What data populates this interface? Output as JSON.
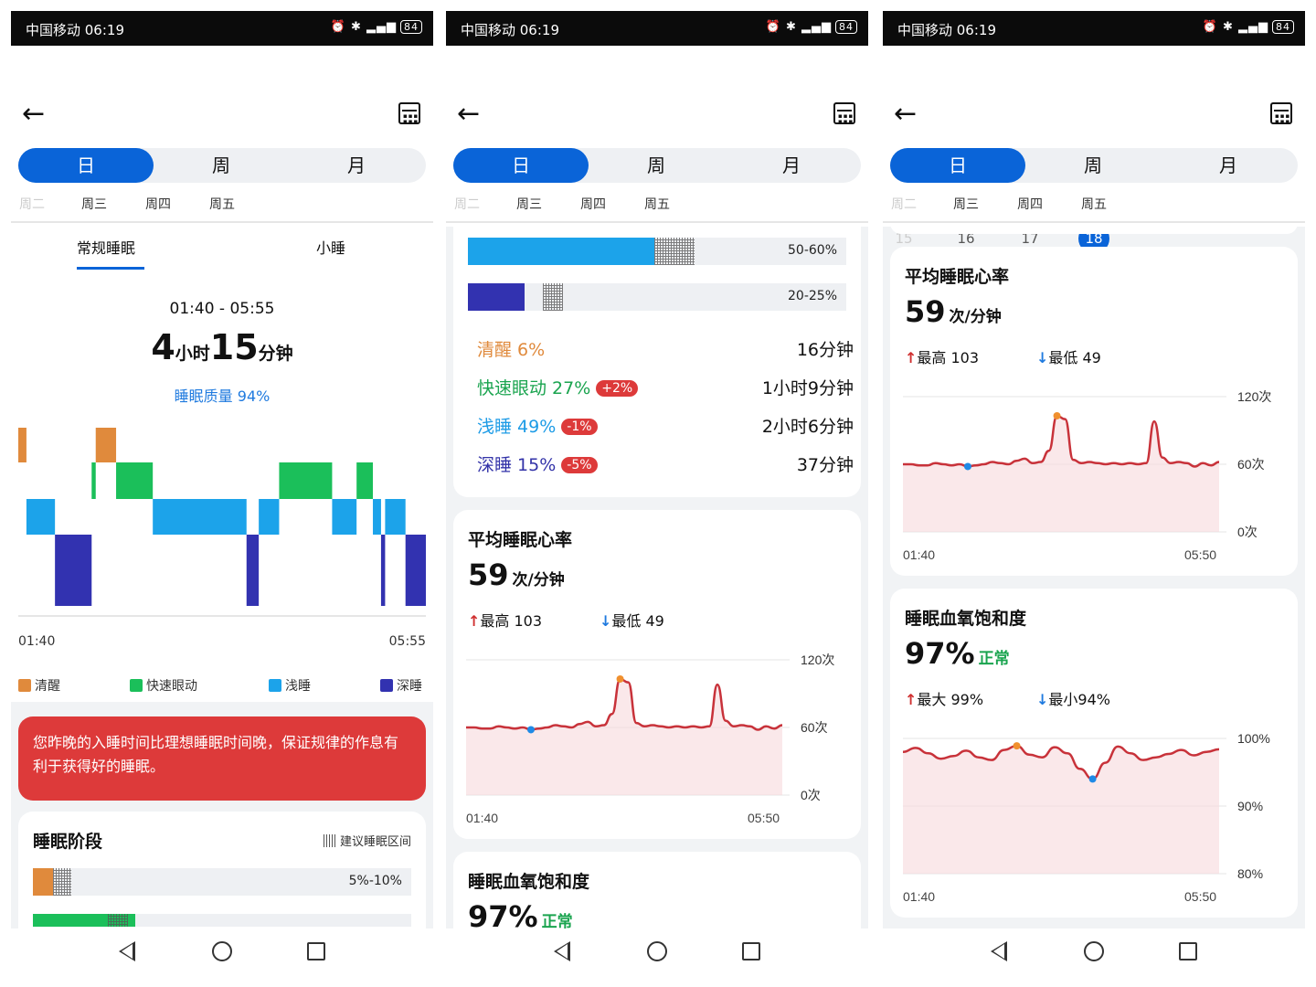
{
  "status_bar": {
    "carrier_time": "中国移动 06:19",
    "icons": "⏰ ✱ ",
    "battery": "84"
  },
  "tabs_period": {
    "day": "日",
    "week": "周",
    "month": "月"
  },
  "days": [
    {
      "name": "周二",
      "date": "15"
    },
    {
      "name": "周三",
      "date": "16"
    },
    {
      "name": "周四",
      "date": "17"
    },
    {
      "name": "周五",
      "date": "18"
    }
  ],
  "sleep_tabs": {
    "regular": "常规睡眠",
    "nap": "小睡"
  },
  "summary": {
    "time_range": "01:40 - 05:55",
    "hours": "4",
    "hours_unit": "小时",
    "minutes": "15",
    "minutes_unit": "分钟",
    "quality": "睡眠质量 94%"
  },
  "hypnogram": {
    "start": "01:40",
    "end": "05:55",
    "legend": {
      "awake": "清醒",
      "rem": "快速眼动",
      "light": "浅睡",
      "deep": "深睡"
    },
    "segments": [
      {
        "stage": "awake",
        "from": 0.0,
        "to": 0.02
      },
      {
        "stage": "light",
        "from": 0.02,
        "to": 0.09
      },
      {
        "stage": "deep",
        "from": 0.09,
        "to": 0.18
      },
      {
        "stage": "rem",
        "from": 0.18,
        "to": 0.19
      },
      {
        "stage": "awake",
        "from": 0.19,
        "to": 0.24
      },
      {
        "stage": "rem",
        "from": 0.24,
        "to": 0.33
      },
      {
        "stage": "light",
        "from": 0.33,
        "to": 0.56
      },
      {
        "stage": "deep",
        "from": 0.56,
        "to": 0.59
      },
      {
        "stage": "light",
        "from": 0.59,
        "to": 0.64
      },
      {
        "stage": "rem",
        "from": 0.64,
        "to": 0.77
      },
      {
        "stage": "light",
        "from": 0.77,
        "to": 0.83
      },
      {
        "stage": "rem",
        "from": 0.83,
        "to": 0.87
      },
      {
        "stage": "light",
        "from": 0.87,
        "to": 0.89
      },
      {
        "stage": "deep",
        "from": 0.89,
        "to": 0.9
      },
      {
        "stage": "light",
        "from": 0.9,
        "to": 0.95
      },
      {
        "stage": "deep",
        "from": 0.95,
        "to": 1.0
      }
    ]
  },
  "advice": "您昨晚的入睡时间比理想睡眠时间晚，保证规律的作息有利于获得好的睡眠。",
  "stages_card": {
    "title": "睡眠阶段",
    "recommended_label": "建议睡眠区间",
    "bars": [
      {
        "stage": "awake",
        "value": 0.06,
        "range": "5%-10%"
      },
      {
        "stage": "rem",
        "value": 0.27,
        "range": "20-25%"
      },
      {
        "stage": "light",
        "value": 0.49,
        "range": "50-60%"
      },
      {
        "stage": "deep",
        "value": 0.15,
        "range": "20-25%"
      }
    ],
    "rows": [
      {
        "label": "清醒 6%",
        "badge": "",
        "duration": "16分钟",
        "color": "#e08a3c"
      },
      {
        "label": "快速眼动 27%",
        "badge": "+2%",
        "duration": "1小时9分钟",
        "color": "#1aa44f"
      },
      {
        "label": "浅睡 49%",
        "badge": "-1%",
        "duration": "2小时6分钟",
        "color": "#1c9be6"
      },
      {
        "label": "深睡 15%",
        "badge": "-5%",
        "duration": "37分钟",
        "color": "#3232a8"
      }
    ]
  },
  "heart_rate": {
    "title": "平均睡眠心率",
    "value": "59",
    "unit": "次/分钟",
    "max_label": "最高 103",
    "min_label": "最低 49",
    "y_ticks": [
      "120次",
      "60次",
      "0次"
    ],
    "x_start": "01:40",
    "x_end": "05:50"
  },
  "spo2": {
    "title": "睡眠血氧饱和度",
    "value": "97%",
    "status": "正常",
    "max_label": "最大 99%",
    "min_label": "最小94%",
    "y_ticks": [
      "100%",
      "90%",
      "80%"
    ],
    "x_start": "01:40",
    "x_end": "05:50"
  },
  "colors": {
    "accent": "#0a64d8",
    "awake": "#e08a3c",
    "rem": "#1bbf5a",
    "light": "#1ca3ea",
    "deep": "#3232b0",
    "line": "#c8323a",
    "warn": "#dd3a3a"
  },
  "chart_data": [
    {
      "type": "line",
      "title": "平均睡眠心率",
      "x_range": [
        "01:40",
        "05:50"
      ],
      "ylim": [
        0,
        120
      ],
      "series": [
        {
          "values": [
            60,
            60,
            59,
            59,
            61,
            60,
            59,
            60,
            58,
            59,
            60,
            62,
            61,
            60,
            63,
            65,
            61,
            62,
            72,
            103,
            100,
            64,
            61,
            62,
            61,
            60,
            61,
            60,
            61,
            60,
            61,
            98,
            66,
            61,
            62,
            61,
            58,
            61,
            59,
            62
          ]
        }
      ]
    },
    {
      "type": "line",
      "title": "睡眠血氧饱和度",
      "x_range": [
        "01:40",
        "05:50"
      ],
      "ylim": [
        80,
        100
      ],
      "series": [
        {
          "values": [
            98,
            98.6,
            97.8,
            97,
            97.4,
            98.2,
            97.2,
            96.8,
            98.3,
            98.9,
            97.6,
            97.2,
            98.7,
            97.8,
            95.5,
            94,
            96.4,
            98.8,
            97.8,
            96.8,
            97.2,
            97.7,
            98.3,
            97.5,
            98,
            98.4
          ]
        }
      ]
    }
  ]
}
